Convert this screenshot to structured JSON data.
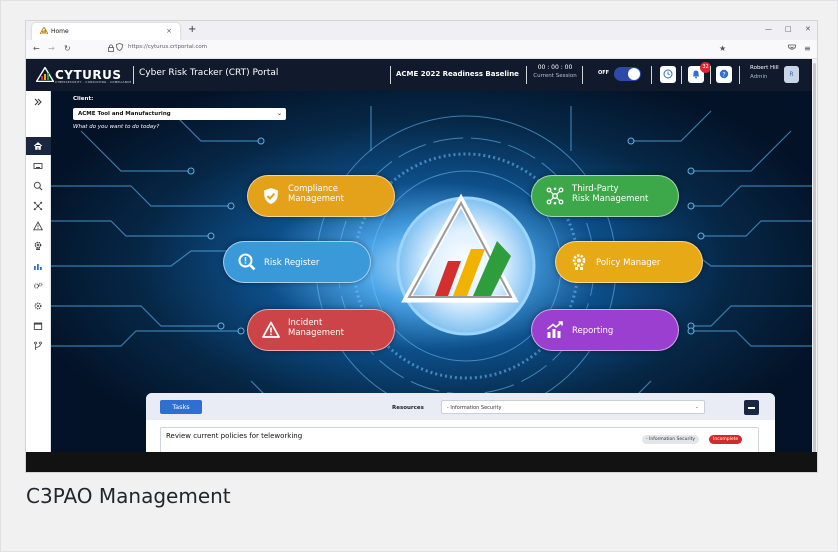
{
  "browser": {
    "tab_title": "Home",
    "tab_close": "×",
    "new_tab": "+",
    "url": "https://cyturus.crtportal.com",
    "win_min": "—",
    "win_max": "□",
    "win_close": "✕"
  },
  "header": {
    "logo_text": "CYTURUS",
    "logo_tagline": "CYBERSECURITY · CONSULTING · COMPLIANCE",
    "portal_title": "Cyber Risk Tracker (CRT) Portal",
    "baseline": "ACME 2022 Readiness Baseline",
    "timer": "00 : 00 : 00",
    "timer_sub": "Current Session",
    "toggle_label": "OFF",
    "notification_count": "32",
    "user_name": "Robert Hill",
    "user_role": "Admin",
    "avatar_initial": "R"
  },
  "client": {
    "label": "Client:",
    "selected": "ACME Tool and Manufacturing",
    "prompt": "What do you want to do today?"
  },
  "modules": [
    {
      "label": "Compliance\nManagement",
      "color": "#e3a21a"
    },
    {
      "label": "Third-Party\nRisk Management",
      "color": "#3ca84a"
    },
    {
      "label": "Risk Register",
      "color": "#3a9ad9"
    },
    {
      "label": "Policy Manager",
      "color": "#e8a916"
    },
    {
      "label": "Incident\nManagement",
      "color": "#cc4448"
    },
    {
      "label": "Reporting",
      "color": "#9a3fd0"
    }
  ],
  "tasks": {
    "button": "Tasks",
    "resources_label": "Resources",
    "resources_selected": "- Information Security",
    "rows": [
      {
        "text": "Review current policies for teleworking",
        "area": "- Information Security",
        "status": "Incomplete"
      }
    ]
  },
  "caption": "C3PAO Management",
  "colors": {
    "header_bg": "#111a2d",
    "main_bg": "#041426",
    "accent": "#2f6fd1",
    "status_incomplete": "#d22b2b"
  }
}
